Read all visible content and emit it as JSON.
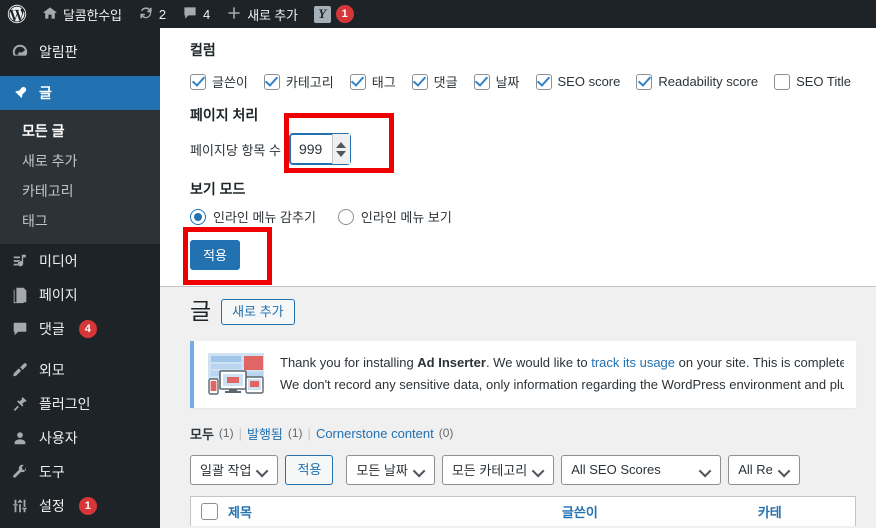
{
  "adminbar": {
    "wp_logo": "wordpress-logo",
    "site_name": "달콤한수입",
    "updates_count": "2",
    "comments_count": "4",
    "new_label": "새로 추가",
    "yoast_label": "Y",
    "yoast_badge": "1"
  },
  "sidebar": {
    "items": [
      {
        "label": "알림판",
        "icon": "dashboard-icon",
        "badge": ""
      },
      {
        "label": "글",
        "icon": "pin-icon",
        "badge": ""
      },
      {
        "label": "미디어",
        "icon": "media-icon",
        "badge": ""
      },
      {
        "label": "페이지",
        "icon": "pages-icon",
        "badge": ""
      },
      {
        "label": "댓글",
        "icon": "comments-icon",
        "badge": "4"
      },
      {
        "label": "외모",
        "icon": "appearance-icon",
        "badge": ""
      },
      {
        "label": "플러그인",
        "icon": "plugins-icon",
        "badge": ""
      },
      {
        "label": "사용자",
        "icon": "users-icon",
        "badge": ""
      },
      {
        "label": "도구",
        "icon": "tools-icon",
        "badge": ""
      },
      {
        "label": "설정",
        "icon": "settings-icon",
        "badge": "1"
      }
    ],
    "submenu": [
      {
        "label": "모든 글"
      },
      {
        "label": "새로 추가"
      },
      {
        "label": "카테고리"
      },
      {
        "label": "태그"
      }
    ]
  },
  "screen_options": {
    "columns_title": "컬럼",
    "columns": [
      {
        "label": "글쓴이",
        "checked": true
      },
      {
        "label": "카테고리",
        "checked": true
      },
      {
        "label": "태그",
        "checked": true
      },
      {
        "label": "댓글",
        "checked": true
      },
      {
        "label": "날짜",
        "checked": true
      },
      {
        "label": "SEO score",
        "checked": true
      },
      {
        "label": "Readability score",
        "checked": true
      },
      {
        "label": "SEO Title",
        "checked": false
      }
    ],
    "pagination_title": "페이지 처리",
    "per_page_label": "페이지당 항목 수",
    "per_page_value": "999",
    "view_mode_title": "보기 모드",
    "view_modes": [
      {
        "label": "인라인 메뉴 감추기",
        "selected": true
      },
      {
        "label": "인라인 메뉴 보기",
        "selected": false
      }
    ],
    "apply_label": "적용"
  },
  "posts_page": {
    "title": "글",
    "add_new_label": "새로 추가",
    "notice": {
      "line1_a": "Thank you for installing ",
      "line1_b": "Ad Inserter",
      "line1_c": ". We would like to ",
      "line1_link": "track its usage",
      "line1_d": " on your site. This is completely o",
      "line2": "We don't record any sensitive data, only information regarding the WordPress environment and plugin"
    },
    "filters": [
      {
        "label": "모두",
        "count": "(1)",
        "current": true
      },
      {
        "label": "발행됨",
        "count": "(1)",
        "current": false
      },
      {
        "label": "Cornerstone content",
        "count": "(0)",
        "current": false
      }
    ],
    "tablenav": {
      "bulk_actions": "일괄 작업",
      "apply_label": "적용",
      "all_dates": "모든 날짜",
      "all_categories": "모든 카테고리",
      "all_seo_scores": "All SEO Scores",
      "all_readability_scores": "All Re"
    },
    "table_headers": [
      {
        "label": "제목"
      },
      {
        "label": "글쓴이"
      },
      {
        "label": "카테"
      }
    ]
  },
  "colors": {
    "admin_bar": "#1d2327",
    "sidebar": "#1d2327",
    "submenu": "#2c3338",
    "active_blue": "#2271b1",
    "badge_red": "#d63638",
    "annotation_red": "#ee0000",
    "notice_border": "#72aee6"
  }
}
